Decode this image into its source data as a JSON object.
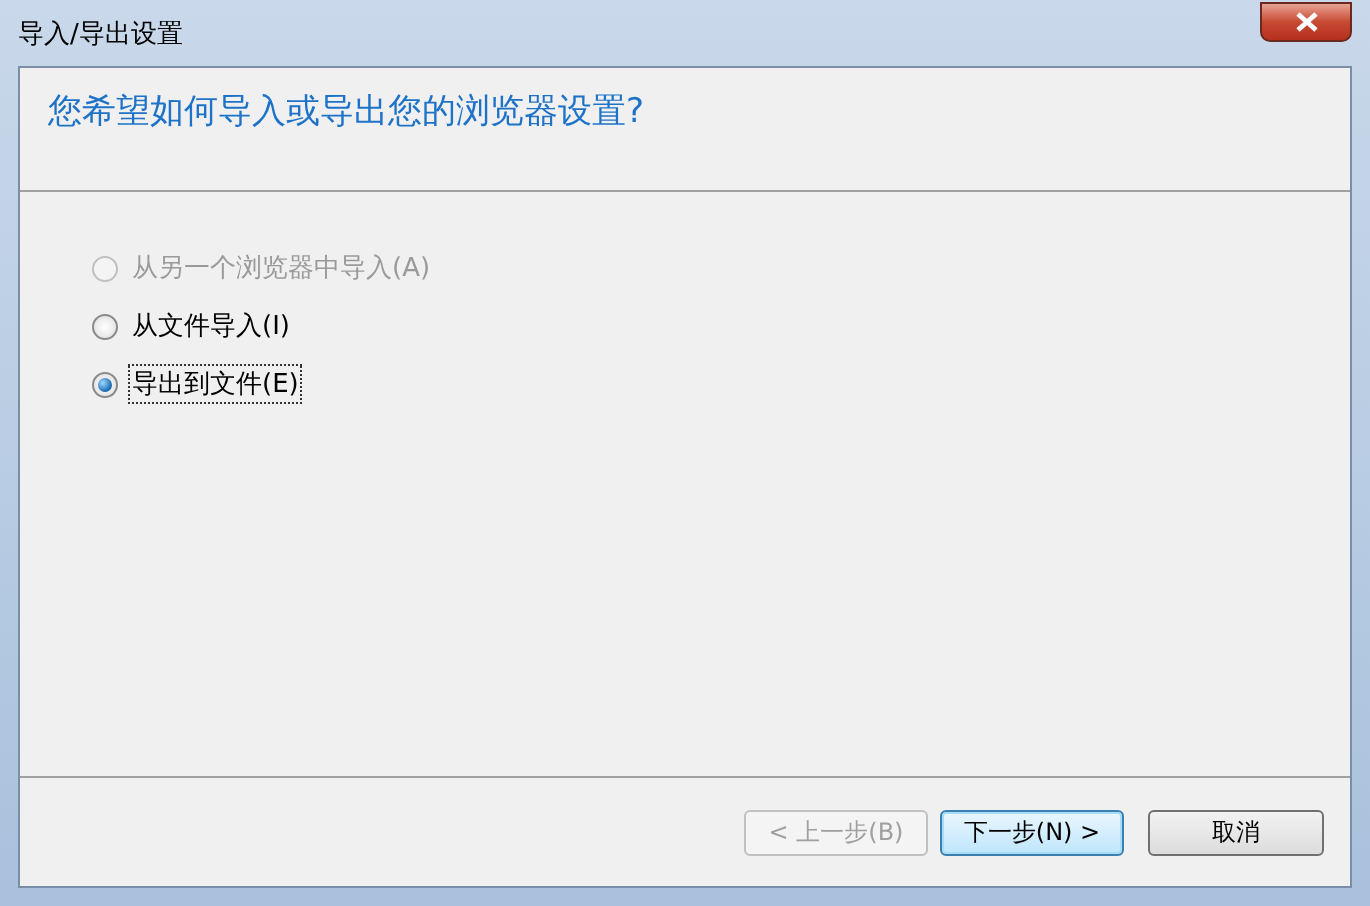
{
  "window": {
    "title": "导入/导出设置"
  },
  "header": {
    "question": "您希望如何导入或导出您的浏览器设置?"
  },
  "options": [
    {
      "label": "从另一个浏览器中导入(A)",
      "selected": false,
      "disabled": true
    },
    {
      "label": "从文件导入(I)",
      "selected": false,
      "disabled": false
    },
    {
      "label": "导出到文件(E)",
      "selected": true,
      "disabled": false
    }
  ],
  "buttons": [
    {
      "label": "< 上一步(B)",
      "disabled": true,
      "default": false
    },
    {
      "label": "下一步(N) >",
      "disabled": false,
      "default": true
    },
    {
      "label": "取消",
      "disabled": false,
      "default": false
    }
  ]
}
